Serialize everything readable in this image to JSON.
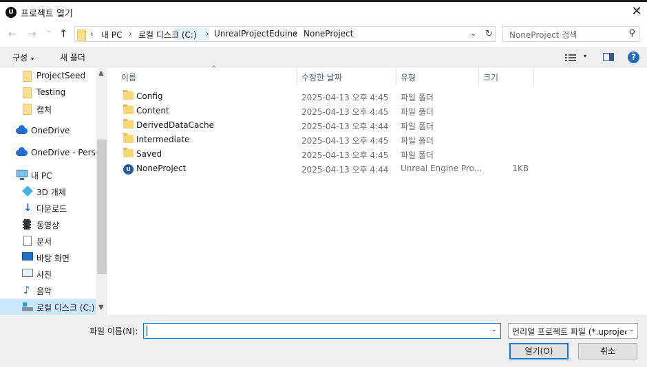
{
  "window": {
    "title": "프로젝트 열기",
    "app_icon_text": "U",
    "close_glyph": "✕"
  },
  "nav": {
    "back": "←",
    "forward": "→",
    "recent": "⌄",
    "up": "↑",
    "breadcrumb": [
      "내 PC",
      "로컬 디스크 (C:)",
      "UnrealProjectEduine",
      "NoneProject"
    ],
    "separator": "›",
    "dropdown": "⌄",
    "refresh": "↻"
  },
  "search": {
    "placeholder": "NoneProject 검색",
    "icon": "search-icon"
  },
  "toolbar": {
    "organize": "구성",
    "new_folder": "새 폴더",
    "caret": "▾",
    "help": "?"
  },
  "sidebar": {
    "items": [
      {
        "label": "ProjectSeed",
        "icon": "folder-icon"
      },
      {
        "label": "Testing",
        "icon": "folder-icon"
      },
      {
        "label": "캡처",
        "icon": "folder-icon"
      },
      {
        "label": "OneDrive",
        "icon": "onedrive-icon"
      },
      {
        "label": "OneDrive - Personal",
        "icon": "onedrive-icon"
      },
      {
        "label": "내 PC",
        "icon": "pc-icon"
      },
      {
        "label": "3D 개체",
        "icon": "3d-objects-icon"
      },
      {
        "label": "다운로드",
        "icon": "download-icon"
      },
      {
        "label": "동영상",
        "icon": "video-icon"
      },
      {
        "label": "문서",
        "icon": "document-icon"
      },
      {
        "label": "바탕 화면",
        "icon": "desktop-icon"
      },
      {
        "label": "사진",
        "icon": "picture-icon"
      },
      {
        "label": "음악",
        "icon": "music-icon"
      },
      {
        "label": "로컬 디스크 (C:)",
        "icon": "drive-icon",
        "selected": true
      }
    ],
    "scroll_up": "▲",
    "scroll_down": "▼"
  },
  "columns": {
    "name": "이름",
    "modified": "수정한 날짜",
    "type": "유형",
    "size": "크기",
    "sort_caret": "^"
  },
  "files": [
    {
      "name": "Config",
      "modified": "2025-04-13 오후 4:45",
      "type": "파일 폴더",
      "size": "",
      "icon": "folder-icon"
    },
    {
      "name": "Content",
      "modified": "2025-04-13 오후 4:45",
      "type": "파일 폴더",
      "size": "",
      "icon": "folder-icon"
    },
    {
      "name": "DerivedDataCache",
      "modified": "2025-04-13 오후 4:44",
      "type": "파일 폴더",
      "size": "",
      "icon": "folder-icon"
    },
    {
      "name": "Intermediate",
      "modified": "2025-04-13 오후 4:45",
      "type": "파일 폴더",
      "size": "",
      "icon": "folder-icon"
    },
    {
      "name": "Saved",
      "modified": "2025-04-13 오후 4:45",
      "type": "파일 폴더",
      "size": "",
      "icon": "folder-icon"
    },
    {
      "name": "NoneProject",
      "modified": "2025-04-13 오후 4:44",
      "type": "Unreal Engine Pro...",
      "size": "1KB",
      "icon": "uproject-icon"
    }
  ],
  "footer": {
    "filename_label": "파일 이름(N):",
    "filename_value": "",
    "filetype": "언리얼 프로젝트 파일 (*.uproject)",
    "open": "열기(O)",
    "cancel": "취소",
    "dropdown": "⌄"
  },
  "colors": {
    "accent": "#0078d7",
    "selection": "#cce8ff",
    "folder": "#f8d775"
  }
}
